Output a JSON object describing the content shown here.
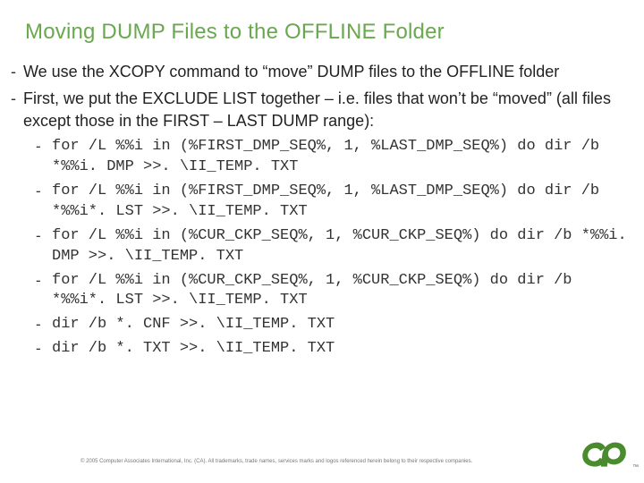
{
  "title": "Moving DUMP Files to the OFFLINE Folder",
  "bullets": [
    {
      "text": "We use the XCOPY command to “move” DUMP files to the OFFLINE folder"
    },
    {
      "text": "First, we put the EXCLUDE LIST together – i.e. files that won’t be “moved” (all files except those in the FIRST – LAST DUMP range):"
    }
  ],
  "code_lines": [
    "for /L %%i in (%FIRST_DMP_SEQ%, 1, %LAST_DMP_SEQ%) do dir /b *%%i. DMP >>. \\II_TEMP. TXT",
    "for /L %%i in (%FIRST_DMP_SEQ%, 1, %LAST_DMP_SEQ%) do dir /b *%%i*. LST >>. \\II_TEMP. TXT",
    "for /L %%i in (%CUR_CKP_SEQ%, 1, %CUR_CKP_SEQ%) do dir /b *%%i. DMP >>. \\II_TEMP. TXT",
    "for /L %%i in (%CUR_CKP_SEQ%, 1, %CUR_CKP_SEQ%) do dir /b *%%i*. LST >>. \\II_TEMP. TXT",
    "dir /b *. CNF >>. \\II_TEMP. TXT",
    "dir /b *. TXT >>. \\II_TEMP. TXT"
  ],
  "footer": "© 2005 Computer Associates International, Inc. (CA). All trademarks, trade names, services marks and logos referenced herein belong to their respective companies.",
  "logo_tm": "™"
}
